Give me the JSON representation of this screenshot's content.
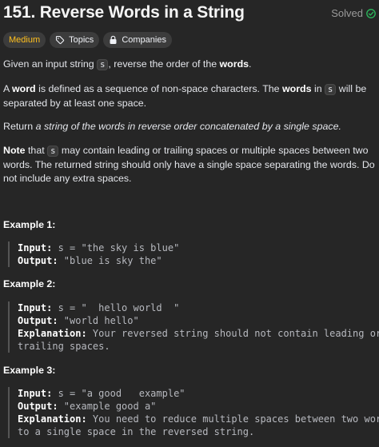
{
  "problem": {
    "title": "151. Reverse Words in a String",
    "status": "Solved",
    "tags": {
      "difficulty": "Medium",
      "topics": "Topics",
      "companies": "Companies"
    }
  },
  "description": {
    "p1_before": "Given an input string ",
    "p1_code": "s",
    "p1_mid": ", reverse the order of the ",
    "p1_bold": "words",
    "p1_end": ".",
    "p2_bold1": "word",
    "p2_a": "A ",
    "p2_b": " is defined as a sequence of non-space characters. The ",
    "p2_bold2": "words",
    "p2_c": " in ",
    "p2_code": "s",
    "p2_d": " will be separated by at least one space.",
    "p3_a": "Return ",
    "p3_italic": "a string of the words in reverse order concatenated by a single space.",
    "p4_bold": "Note",
    "p4_a": " that ",
    "p4_code": "s",
    "p4_b": " may contain leading or trailing spaces or multiple spaces between two words. The returned string should only have a single space separating the words. Do not include any extra spaces."
  },
  "examples": [
    {
      "label": "Example 1:",
      "input_key": "Input:",
      "input_val": " s = \"the sky is blue\"",
      "output_key": "Output:",
      "output_val": " \"blue is sky the\""
    },
    {
      "label": "Example 2:",
      "input_key": "Input:",
      "input_val": " s = \"  hello world  \"",
      "output_key": "Output:",
      "output_val": " \"world hello\"",
      "explanation_key": "Explanation:",
      "explanation_val": " Your reversed string should not contain leading or\ntrailing spaces."
    },
    {
      "label": "Example 3:",
      "input_key": "Input:",
      "input_val": " s = \"a good   example\"",
      "output_key": "Output:",
      "output_val": " \"example good a\"",
      "explanation_key": "Explanation:",
      "explanation_val": " You need to reduce multiple spaces between two words\nto a single space in the reversed string."
    }
  ]
}
